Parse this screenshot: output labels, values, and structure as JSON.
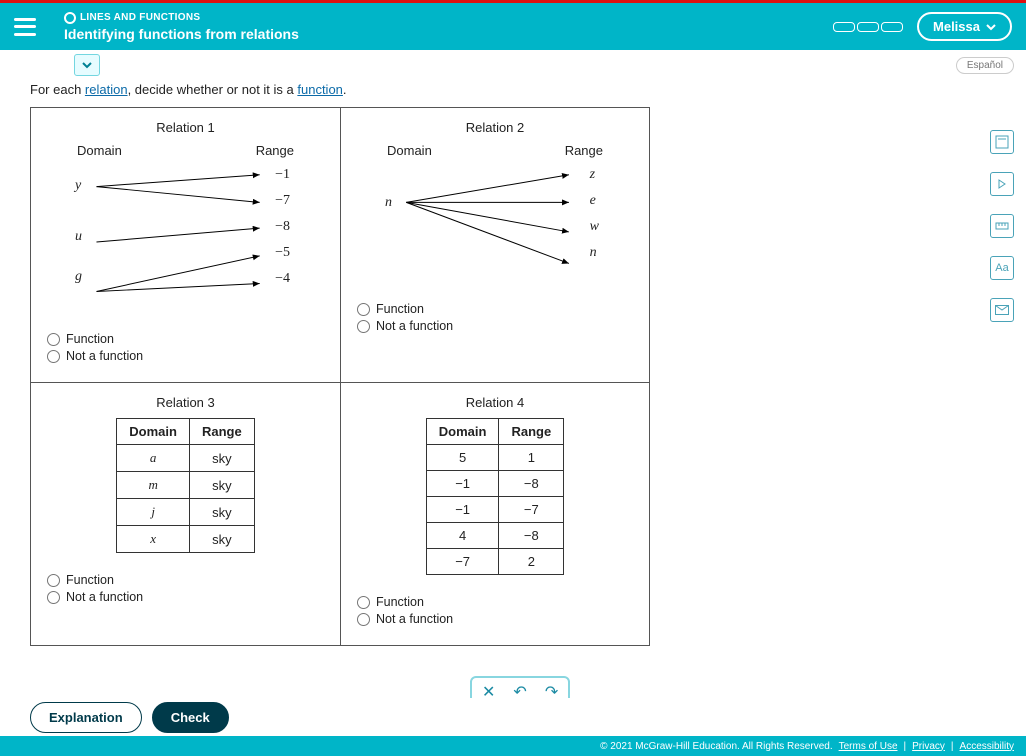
{
  "header": {
    "kicker": "LINES AND FUNCTIONS",
    "title": "Identifying functions from relations",
    "user": "Melissa",
    "language_toggle": "Español"
  },
  "prompt": {
    "pre": "For each ",
    "link1": "relation",
    "mid": ", decide whether or not it is a ",
    "link2": "function",
    "post": "."
  },
  "labels": {
    "domain": "Domain",
    "range": "Range",
    "function": "Function",
    "not_function": "Not a function"
  },
  "relations": {
    "r1": {
      "title": "Relation 1",
      "domain": [
        "y",
        "u",
        "g"
      ],
      "range": [
        "−1",
        "−7",
        "−8",
        "−5",
        "−4"
      ]
    },
    "r2": {
      "title": "Relation 2",
      "domain": [
        "n"
      ],
      "range": [
        "z",
        "e",
        "w",
        "n"
      ]
    },
    "r3": {
      "title": "Relation 3",
      "rows": [
        {
          "d": "a",
          "r": "sky"
        },
        {
          "d": "m",
          "r": "sky"
        },
        {
          "d": "j",
          "r": "sky"
        },
        {
          "d": "x",
          "r": "sky"
        }
      ]
    },
    "r4": {
      "title": "Relation 4",
      "rows": [
        {
          "d": "5",
          "r": "1"
        },
        {
          "d": "−1",
          "r": "−8"
        },
        {
          "d": "−1",
          "r": "−7"
        },
        {
          "d": "4",
          "r": "−8"
        },
        {
          "d": "−7",
          "r": "2"
        }
      ]
    }
  },
  "buttons": {
    "explanation": "Explanation",
    "check": "Check"
  },
  "footer": {
    "copyright": "© 2021 McGraw-Hill Education. All Rights Reserved.",
    "terms": "Terms of Use",
    "privacy": "Privacy",
    "accessibility": "Accessibility"
  },
  "tool_icons": [
    "calculator-icon",
    "play-icon",
    "ruler-icon",
    "font-icon",
    "mail-icon"
  ]
}
